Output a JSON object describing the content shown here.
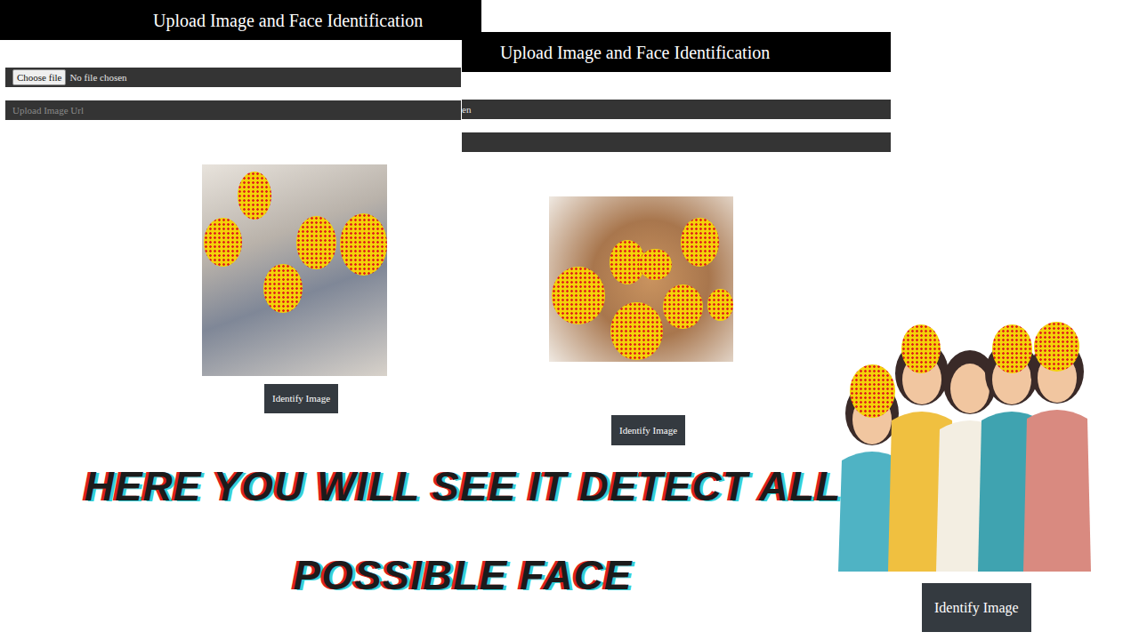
{
  "windows": [
    {
      "kind": "full",
      "title": "Upload Image and Face Identification",
      "file_button": "Choose file",
      "file_status": "No file chosen",
      "url_placeholder": "Upload Image Url",
      "button": "Identify Image"
    },
    {
      "kind": "partial",
      "title": "Upload Image and Face Identification",
      "file_status": "en",
      "button": "Identify Image"
    },
    {
      "kind": "cropped",
      "button": "Identify Image"
    }
  ],
  "caption": [
    "HERE YOU WILL SEE IT DETECT ALL",
    "POSSIBLE FACE"
  ]
}
